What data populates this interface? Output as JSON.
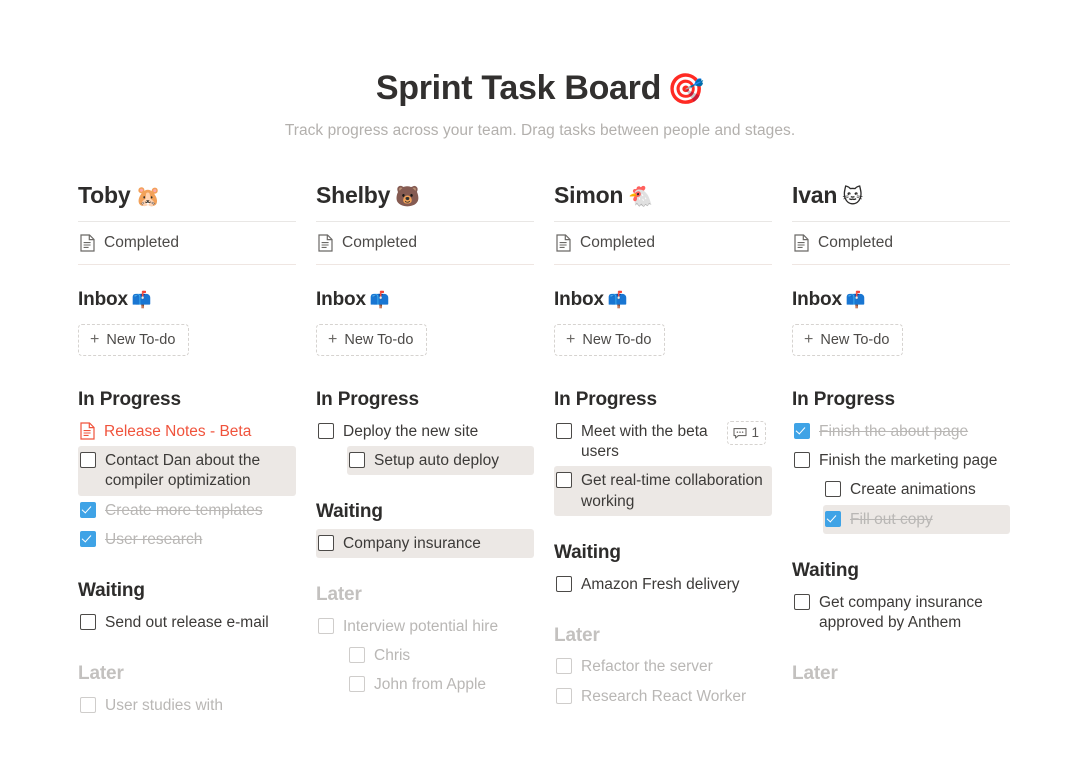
{
  "header": {
    "title": "Sprint Task Board",
    "title_emoji": "🎯",
    "subtitle": "Track progress across your team.  Drag tasks between people and stages."
  },
  "labels": {
    "completed": "Completed",
    "inbox": "Inbox",
    "inbox_emoji": "📫",
    "new_todo": "New To-do",
    "plus": "+",
    "in_progress": "In Progress",
    "waiting": "Waiting",
    "later": "Later"
  },
  "colors": {
    "accent_red": "#f0533c",
    "checkbox_blue": "#3fa3e6",
    "highlight": "#ece8e5",
    "muted_text": "#b9b7b5",
    "subtitle": "#b3b0ad"
  },
  "columns": [
    {
      "name": "Toby",
      "emoji": "🐹",
      "in_progress": [
        {
          "text": "Release Notes - Beta",
          "type": "doc",
          "accent": true,
          "indent": 0,
          "checked": false,
          "highlight": false,
          "dim": false
        },
        {
          "text": "Contact Dan about the compiler optimization",
          "type": "checkbox",
          "accent": false,
          "indent": 0,
          "checked": false,
          "highlight": true,
          "dim": false
        },
        {
          "text": "Create more templates",
          "type": "checkbox",
          "accent": false,
          "indent": 0,
          "checked": true,
          "highlight": false,
          "dim": false
        },
        {
          "text": "User research",
          "type": "checkbox",
          "accent": false,
          "indent": 0,
          "checked": true,
          "highlight": false,
          "dim": false
        }
      ],
      "waiting": [
        {
          "text": "Send out release e-mail",
          "type": "checkbox",
          "indent": 0,
          "checked": false,
          "highlight": false,
          "dim": false
        }
      ],
      "later": [
        {
          "text": "User studies with",
          "type": "checkbox",
          "indent": 0,
          "checked": false,
          "highlight": false,
          "dim": true
        }
      ]
    },
    {
      "name": "Shelby",
      "emoji": "🐻",
      "in_progress": [
        {
          "text": "Deploy the new site",
          "type": "checkbox",
          "indent": 0,
          "checked": false,
          "highlight": false,
          "dim": false
        },
        {
          "text": "Setup auto deploy",
          "type": "checkbox",
          "indent": 1,
          "checked": false,
          "highlight": true,
          "dim": false
        }
      ],
      "waiting": [
        {
          "text": "Company insurance",
          "type": "checkbox",
          "indent": 0,
          "checked": false,
          "highlight": true,
          "dim": false
        }
      ],
      "later": [
        {
          "text": "Interview potential hire",
          "type": "checkbox",
          "indent": 0,
          "checked": false,
          "highlight": false,
          "dim": true
        },
        {
          "text": "Chris",
          "type": "checkbox",
          "indent": 1,
          "checked": false,
          "highlight": false,
          "dim": true
        },
        {
          "text": "John from Apple",
          "type": "checkbox",
          "indent": 1,
          "checked": false,
          "highlight": false,
          "dim": true
        }
      ]
    },
    {
      "name": "Simon",
      "emoji": "🐔",
      "in_progress": [
        {
          "text": "Meet with the beta users",
          "type": "checkbox",
          "indent": 0,
          "checked": false,
          "highlight": false,
          "dim": false,
          "comments": "1"
        },
        {
          "text": "Get real-time collaboration working",
          "type": "checkbox",
          "indent": 0,
          "checked": false,
          "highlight": true,
          "dim": false
        }
      ],
      "waiting": [
        {
          "text": "Amazon Fresh delivery",
          "type": "checkbox",
          "indent": 0,
          "checked": false,
          "highlight": false,
          "dim": false
        }
      ],
      "later": [
        {
          "text": "Refactor the server",
          "type": "checkbox",
          "indent": 0,
          "checked": false,
          "highlight": false,
          "dim": true
        },
        {
          "text": "Research React Worker",
          "type": "checkbox",
          "indent": 0,
          "checked": false,
          "highlight": false,
          "dim": true
        }
      ]
    },
    {
      "name": "Ivan",
      "emoji": "🐱",
      "in_progress": [
        {
          "text": "Finish the about page",
          "type": "checkbox",
          "indent": 0,
          "checked": true,
          "highlight": false,
          "dim": false
        },
        {
          "text": "Finish the marketing page",
          "type": "checkbox",
          "indent": 0,
          "checked": false,
          "highlight": false,
          "dim": false
        },
        {
          "text": "Create animations",
          "type": "checkbox",
          "indent": 1,
          "checked": false,
          "highlight": false,
          "dim": false
        },
        {
          "text": "Fill out copy",
          "type": "checkbox",
          "indent": 1,
          "checked": true,
          "highlight": true,
          "dim": false
        }
      ],
      "waiting": [
        {
          "text": "Get company insurance approved by Anthem",
          "type": "checkbox",
          "indent": 0,
          "checked": false,
          "highlight": false,
          "dim": false
        }
      ],
      "later": []
    }
  ]
}
